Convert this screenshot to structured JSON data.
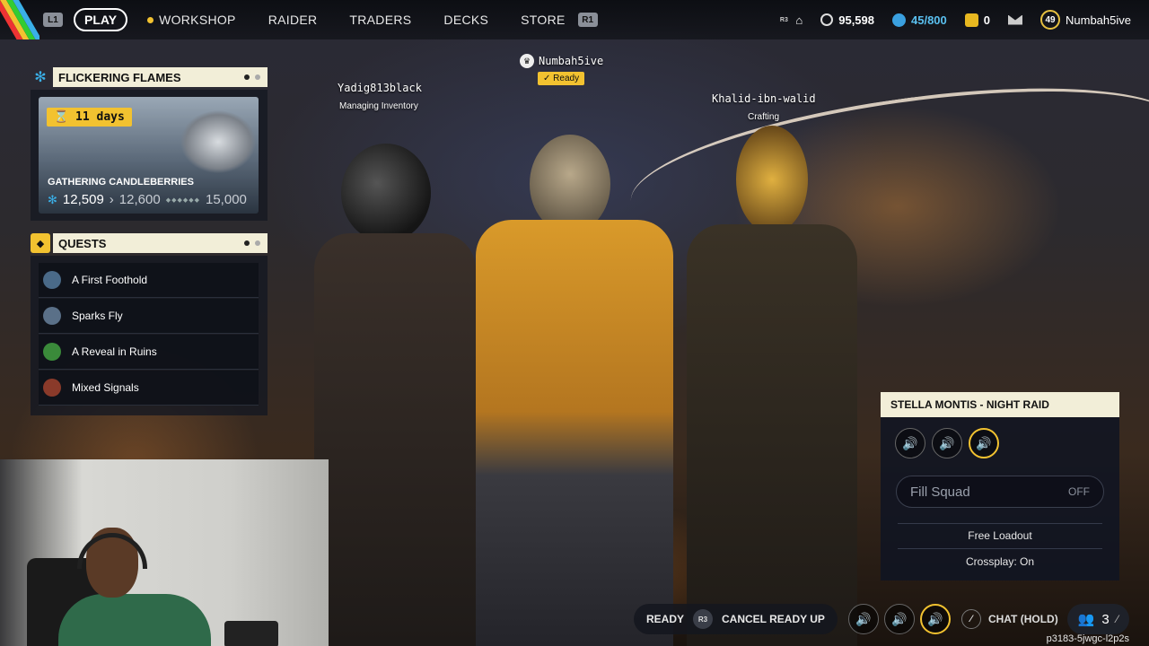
{
  "nav": {
    "left_bumper": "L1",
    "right_bumper": "R1",
    "play": "PLAY",
    "items": [
      "WORKSHOP",
      "RAIDER",
      "TRADERS",
      "DECKS",
      "STORE"
    ]
  },
  "stats": {
    "r3_label": "R3",
    "coins": "95,598",
    "blue_currency": "45/800",
    "tokens": "0",
    "level": "49",
    "username": "Numbah5ive"
  },
  "event": {
    "title": "FLICKERING FLAMES",
    "days": "11 days",
    "name": "GATHERING CANDLEBERRIES",
    "current": "12,509",
    "next": "12,600",
    "target": "15,000"
  },
  "quests": {
    "title": "QUESTS",
    "items": [
      {
        "label": "A First Foothold",
        "color": "#4a6a88"
      },
      {
        "label": "Sparks Fly",
        "color": "#5a7088"
      },
      {
        "label": "A Reveal in Ruins",
        "color": "#3a8a3a"
      },
      {
        "label": "Mixed Signals",
        "color": "#8a3a2a"
      }
    ]
  },
  "players": [
    {
      "name": "Yadig813black",
      "status": "Managing Inventory"
    },
    {
      "name": "Numbah5ive",
      "status": "Ready"
    },
    {
      "name": "Khalid-ibn-walid",
      "status": "Crafting"
    }
  ],
  "raid": {
    "title": "STELLA MONTIS - NIGHT RAID",
    "fill_squad": "Fill Squad",
    "fill_value": "OFF",
    "loadout": "Free Loadout",
    "crossplay": "Crossplay: On"
  },
  "bottom": {
    "ready": "READY",
    "r3": "R3",
    "cancel": "CANCEL READY UP",
    "chat": "CHAT (HOLD)",
    "squad_count": "3",
    "session": "p3183-5jwgc-l2p2s"
  }
}
